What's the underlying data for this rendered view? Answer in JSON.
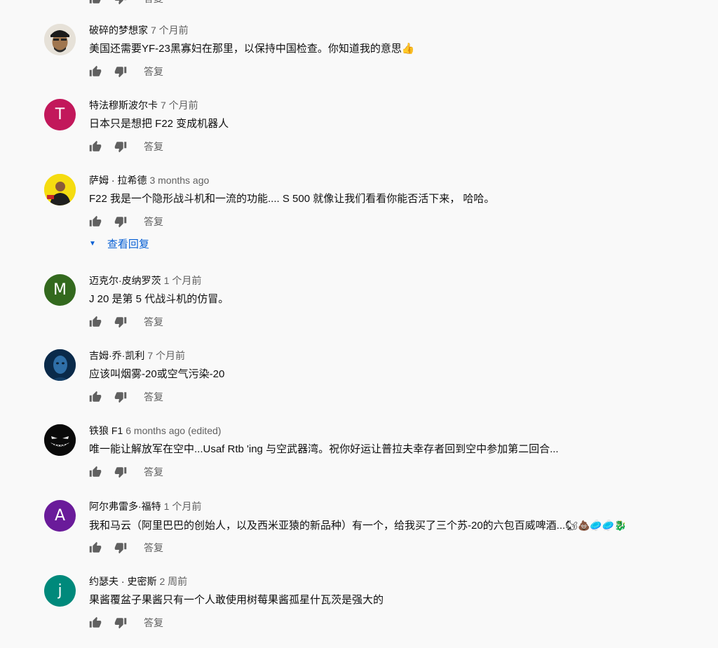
{
  "top_actions": {
    "reply_label": "答复"
  },
  "view_replies_label": "查看回复",
  "comments": [
    {
      "author": "破碎的梦想家",
      "time": "7 个月前",
      "text": "美国还需要YF-23黑寡妇在那里，以保持中国检查。你知道我的意思👍",
      "avatar_letter": "",
      "avatar_color": "#8a6a52",
      "reply_label": "答复"
    },
    {
      "author": "特法穆斯波尔卡",
      "time": "7 个月前",
      "text": "日本只是想把 F22 变成机器人",
      "avatar_letter": "T",
      "avatar_color": "#c2185b",
      "reply_label": "答复"
    },
    {
      "author": "萨姆 · 拉希德",
      "time": "3 months ago",
      "text": "F22 我是一个隐形战斗机和一流的功能.... S 500 就像让我们看看你能否活下来， 哈哈。",
      "avatar_letter": "",
      "avatar_color": "#f2d600",
      "reply_label": "答复"
    },
    {
      "author": "迈克尔·皮纳罗茨",
      "time": "1 个月前",
      "text": "J 20 是第 5 代战斗机的仿冒。",
      "avatar_letter": "M",
      "avatar_color": "#33691e",
      "reply_label": "答复"
    },
    {
      "author": "吉姆·乔·凯利",
      "time": "7 个月前",
      "text": "应该叫烟雾-20或空气污染-20",
      "avatar_letter": "",
      "avatar_color": "#0d3b66",
      "reply_label": "答复"
    },
    {
      "author": "铁狼 F1",
      "time": "6 months ago (edited)",
      "text": "唯一能让解放军在空中...Usaf Rtb 'ing 与空武器湾。祝你好运让普拉夫幸存者回到空中参加第二回合...",
      "avatar_letter": "",
      "avatar_color": "#111111",
      "reply_label": "答复"
    },
    {
      "author": "阿尔弗雷多·福特",
      "time": "1 个月前",
      "text": "我和马云（阿里巴巴的创始人，以及西米亚猿的新品种）有一个，给我买了三个苏-20的六包百威啤酒...",
      "emoji": "🐿💩🥏🥏🐉",
      "avatar_letter": "A",
      "avatar_color": "#6a1b9a",
      "reply_label": "答复"
    },
    {
      "author": "约瑟夫 · 史密斯",
      "time": "2 周前",
      "text": "果酱覆盆子果酱只有一个人敢使用树莓果酱孤星什瓦茨是强大的",
      "avatar_letter": "j",
      "avatar_color": "#00897b",
      "reply_label": "答复"
    }
  ]
}
